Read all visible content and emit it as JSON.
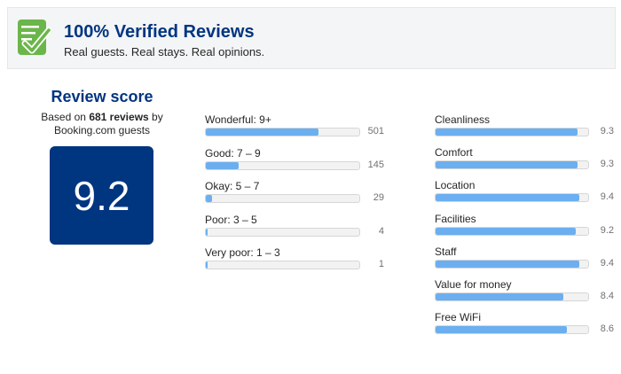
{
  "banner": {
    "title": "100% Verified Reviews",
    "subtitle": "Real guests. Real stays. Real opinions.",
    "icon": "verified-checklist-icon",
    "icon_color": "#6bb64a"
  },
  "score": {
    "title": "Review score",
    "based_on_prefix": "Based on",
    "review_count": "681 reviews",
    "based_on_suffix": "by",
    "source": "Booking.com guests",
    "value": "9.2",
    "box_color": "#003580"
  },
  "distribution": [
    {
      "label": "Wonderful: 9+",
      "count": "501",
      "fraction": 0.736
    },
    {
      "label": "Good: 7 – 9",
      "count": "145",
      "fraction": 0.213
    },
    {
      "label": "Okay: 5 – 7",
      "count": "29",
      "fraction": 0.043
    },
    {
      "label": "Poor: 3 – 5",
      "count": "4",
      "fraction": 0.006
    },
    {
      "label": "Very poor: 1 – 3",
      "count": "1",
      "fraction": 0.0015
    }
  ],
  "categories": [
    {
      "label": "Cleanliness",
      "score": "9.3",
      "fraction": 0.93
    },
    {
      "label": "Comfort",
      "score": "9.3",
      "fraction": 0.93
    },
    {
      "label": "Location",
      "score": "9.4",
      "fraction": 0.94
    },
    {
      "label": "Facilities",
      "score": "9.2",
      "fraction": 0.92
    },
    {
      "label": "Staff",
      "score": "9.4",
      "fraction": 0.94
    },
    {
      "label": "Value for money",
      "score": "8.4",
      "fraction": 0.84
    },
    {
      "label": "Free WiFi",
      "score": "8.6",
      "fraction": 0.86
    }
  ],
  "colors": {
    "bar_fill": "#6baff0",
    "bar_track": "#f2f2f2",
    "heading": "#003580"
  }
}
